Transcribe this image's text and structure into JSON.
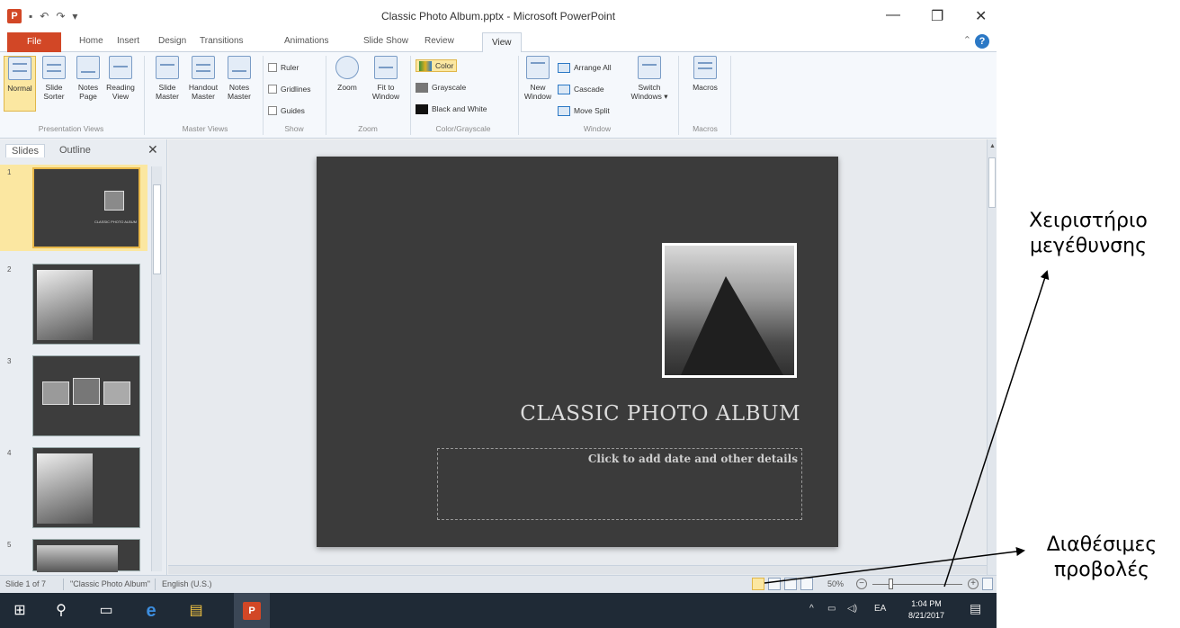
{
  "window": {
    "title": "Classic Photo Album.pptx - Microsoft PowerPoint",
    "qat": [
      "↶",
      "↷",
      "▾"
    ],
    "controls": {
      "minimize": "—",
      "restore": "❐",
      "close": "✕"
    }
  },
  "tabs": {
    "file": "File",
    "items": [
      "Home",
      "Insert",
      "Design",
      "Transitions",
      "Animations",
      "Slide Show",
      "Review",
      "View"
    ],
    "active": "View",
    "help": "?"
  },
  "ribbon": {
    "groups": {
      "presentation_views": {
        "label": "Presentation Views",
        "buttons": [
          {
            "l1": "Normal",
            "l2": ""
          },
          {
            "l1": "Slide",
            "l2": "Sorter"
          },
          {
            "l1": "Notes",
            "l2": "Page"
          },
          {
            "l1": "Reading",
            "l2": "View"
          }
        ]
      },
      "master_views": {
        "label": "Master Views",
        "buttons": [
          {
            "l1": "Slide",
            "l2": "Master"
          },
          {
            "l1": "Handout",
            "l2": "Master"
          },
          {
            "l1": "Notes",
            "l2": "Master"
          }
        ]
      },
      "show": {
        "label": "Show",
        "items": [
          "Ruler",
          "Gridlines",
          "Guides"
        ]
      },
      "zoom": {
        "label": "Zoom",
        "buttons": [
          {
            "l1": "Zoom",
            "l2": ""
          },
          {
            "l1": "Fit to",
            "l2": "Window"
          }
        ]
      },
      "color": {
        "label": "Color/Grayscale",
        "items": [
          "Color",
          "Grayscale",
          "Black and White"
        ]
      },
      "window": {
        "label": "Window",
        "new_window": {
          "l1": "New",
          "l2": "Window"
        },
        "items": [
          "Arrange All",
          "Cascade",
          "Move Split"
        ],
        "switch": {
          "l1": "Switch",
          "l2": "Windows ▾"
        }
      },
      "macros": {
        "label": "Macros",
        "button": "Macros"
      }
    }
  },
  "panel": {
    "tabs": [
      "Slides",
      "Outline"
    ],
    "close": "✕",
    "slides": [
      {
        "num": "1",
        "title": "CLASSIC PHOTO ALBUM"
      },
      {
        "num": "2",
        "title": ""
      },
      {
        "num": "3",
        "title": ""
      },
      {
        "num": "4",
        "title": ""
      },
      {
        "num": "5",
        "title": ""
      }
    ]
  },
  "slide": {
    "title": "CLASSIC PHOTO ALBUM",
    "subtitle": "Click to add date and other details"
  },
  "status": {
    "slide_info": "Slide 1 of 7",
    "theme": "\"Classic Photo Album\"",
    "language": "English (U.S.)",
    "zoom": "50%",
    "zoom_out": "−",
    "zoom_in": "+"
  },
  "taskbar": {
    "start": "⊞",
    "search": "⚲",
    "task_view": "▭",
    "edge": "e",
    "explorer": "▤",
    "ppt": "P",
    "tray": {
      "chevron": "^",
      "net": "▭",
      "vol": "◁)",
      "lang": "EA"
    },
    "time": "1:04 PM",
    "date": "8/21/2017",
    "notify": "▤"
  },
  "annotations": {
    "zoom_handle": "Χειριστήριο μεγέθυνσης",
    "views": "Διαθέσιμες προβολές"
  },
  "colors": {
    "file_tab": "#d24726",
    "selected": "#fbe7a1",
    "slide_bg": "#3b3b3b",
    "taskbar": "#1f2a36"
  }
}
